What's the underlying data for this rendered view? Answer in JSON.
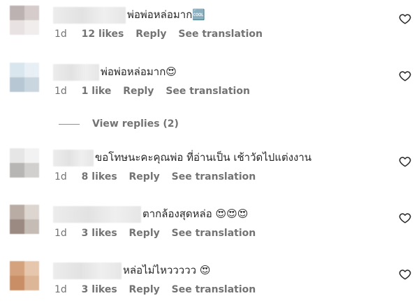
{
  "comments": [
    {
      "text": "พ่อพ่อหล่อมาก🆒",
      "time": "1d",
      "likes": "12 likes",
      "reply_label": "Reply",
      "translation_label": "See translation"
    },
    {
      "text": "พ่อพ่อหล่อมาก😍",
      "time": "1d",
      "likes": "1 like",
      "reply_label": "Reply",
      "translation_label": "See translation"
    },
    {
      "text": "ขอโทษนะคะคุณพ่อ ที่อ่านเป็น เช้าวัดไปแต่งงาน",
      "time": "1d",
      "likes": "8 likes",
      "reply_label": "Reply",
      "translation_label": "See translation"
    },
    {
      "text": "ตากล้องสุดหล่อ 😍😍😍",
      "time": "1d",
      "likes": "3 likes",
      "reply_label": "Reply",
      "translation_label": "See translation"
    },
    {
      "text": "หล่อไม่ไหววววว 😍",
      "time": "1d",
      "likes": "3 likes",
      "reply_label": "Reply",
      "translation_label": "See translation"
    }
  ],
  "view_replies": "View replies (2)",
  "icons": {
    "like": "heart-outline-icon"
  },
  "colors": {
    "text": "#262626",
    "secondary": "#737373"
  }
}
